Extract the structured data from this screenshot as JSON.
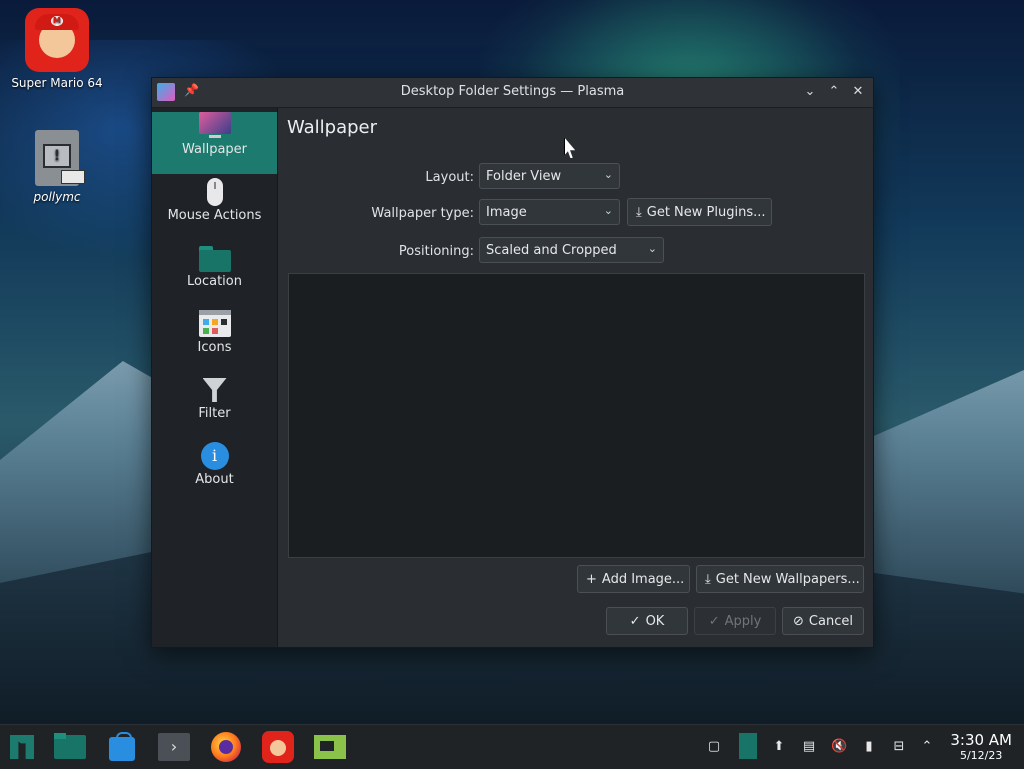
{
  "desktop": {
    "icons": [
      {
        "label": "Super Mario 64"
      },
      {
        "label": "pollymc"
      }
    ]
  },
  "window": {
    "title": "Desktop Folder Settings — Plasma",
    "sidebar": [
      {
        "label": "Wallpaper",
        "icon": "monitor-icon",
        "active": true
      },
      {
        "label": "Mouse Actions",
        "icon": "mouse-icon"
      },
      {
        "label": "Location",
        "icon": "folder-icon"
      },
      {
        "label": "Icons",
        "icon": "icons-grid-icon"
      },
      {
        "label": "Filter",
        "icon": "funnel-icon"
      },
      {
        "label": "About",
        "icon": "info-icon"
      }
    ],
    "heading": "Wallpaper",
    "layout": {
      "label": "Layout:",
      "value": "Folder View"
    },
    "wallpaper_type": {
      "label": "Wallpaper type:",
      "value": "Image",
      "plugins_button": "Get New Plugins..."
    },
    "positioning": {
      "label": "Positioning:",
      "value": "Scaled and Cropped"
    },
    "add_image_button": "Add Image...",
    "get_wallpapers_button": "Get New Wallpapers...",
    "ok_button": "OK",
    "apply_button": "Apply",
    "cancel_button": "Cancel"
  },
  "taskbar": {
    "time": "3:30 AM",
    "date": "5/12/23"
  },
  "colors": {
    "accent": "#1c7a6e",
    "window_bg": "#2a2e32",
    "sidebar_bg": "#1f2226"
  }
}
